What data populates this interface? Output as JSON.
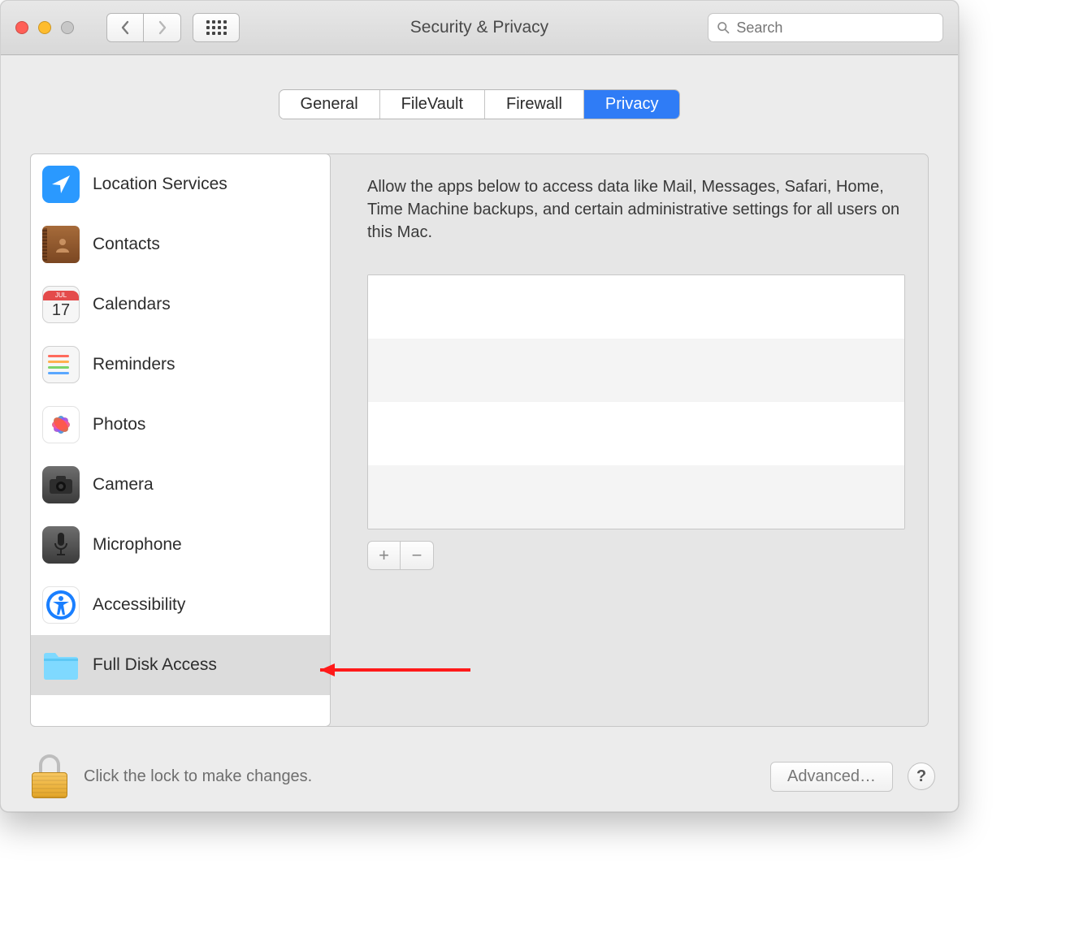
{
  "window": {
    "title": "Security & Privacy"
  },
  "search": {
    "placeholder": "Search"
  },
  "tabs": [
    {
      "label": "General",
      "active": false
    },
    {
      "label": "FileVault",
      "active": false
    },
    {
      "label": "Firewall",
      "active": false
    },
    {
      "label": "Privacy",
      "active": true
    }
  ],
  "sidebar": {
    "items": [
      {
        "label": "Location Services",
        "icon": "location",
        "selected": false
      },
      {
        "label": "Contacts",
        "icon": "contacts",
        "selected": false
      },
      {
        "label": "Calendars",
        "icon": "calendar",
        "selected": false
      },
      {
        "label": "Reminders",
        "icon": "reminders",
        "selected": false
      },
      {
        "label": "Photos",
        "icon": "photos",
        "selected": false
      },
      {
        "label": "Camera",
        "icon": "camera",
        "selected": false
      },
      {
        "label": "Microphone",
        "icon": "microphone",
        "selected": false
      },
      {
        "label": "Accessibility",
        "icon": "accessibility",
        "selected": false
      },
      {
        "label": "Full Disk Access",
        "icon": "folder",
        "selected": true
      }
    ]
  },
  "calendar_tile": {
    "month": "JUL",
    "day": "17"
  },
  "detail": {
    "description": "Allow the apps below to access data like Mail, Messages, Safari, Home, Time Machine backups, and certain administrative settings for all users on this Mac."
  },
  "footer": {
    "lock_hint": "Click the lock to make changes.",
    "advanced_label": "Advanced…",
    "help_label": "?"
  },
  "buttons": {
    "add": "+",
    "remove": "−"
  }
}
